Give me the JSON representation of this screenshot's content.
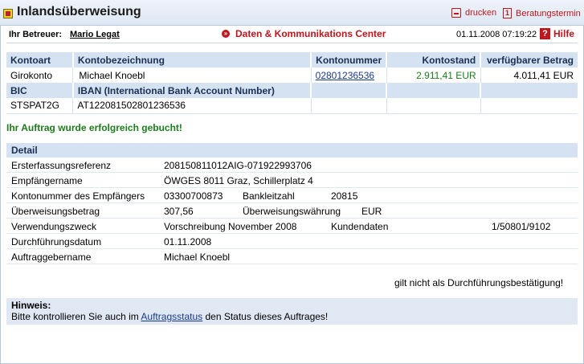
{
  "header": {
    "title": "Inlandsüberweisung",
    "print_label": "drucken",
    "termin_label": "Beratungstermin"
  },
  "subheader": {
    "betreuer_label": "Ihr Betreuer:",
    "betreuer_name": "Mario Legat",
    "center_link": "Daten & Kommunikations Center",
    "datetime": "01.11.2008 07:19:22",
    "help_label": "Hilfe"
  },
  "account": {
    "headers": [
      "Kontoart",
      "Kontobezeichnung",
      "Kontonummer",
      "Kontostand",
      "verfügbarer Betrag"
    ],
    "row": {
      "kontoart": "Girokonto",
      "bezeichnung": "Michael Knoebl",
      "nummer": "02801236536",
      "stand": "2.911,41 EUR",
      "verfuegbar": "4.011,41 EUR"
    },
    "headers2": [
      "BIC",
      "IBAN (International Bank Account Number)"
    ],
    "row2": {
      "bic": "STSPAT2G",
      "iban": "AT122081502801236536"
    }
  },
  "success_message": "Ihr Auftrag wurde erfolgreich gebucht!",
  "detail": {
    "heading": "Detail",
    "ersterfassung_label": "Ersterfassungsreferenz",
    "ersterfassung_value": "208150811012AIG-071922993706",
    "empfaenger_label": "Empfängername",
    "empfaenger_value": "ÖWGES 8011 Graz, Schillerplatz 4",
    "kontonr_label": "Kontonummer des Empfängers",
    "kontonr_value": "03300700873",
    "blz_label": "Bankleitzahl",
    "blz_value": "20815",
    "betrag_label": "Überweisungsbetrag",
    "betrag_value": "307,56",
    "waehrung_label": "Überweisungswährung",
    "waehrung_value": "EUR",
    "zweck_label": "Verwendungszweck",
    "zweck_value": "Vorschreibung November 2008",
    "kundendaten_label": "Kundendaten",
    "kundendaten_value": "1/50801/9102",
    "datum_label": "Durchführungsdatum",
    "datum_value": "01.11.2008",
    "auftraggeber_label": "Auftraggebername",
    "auftraggeber_value": "Michael Knoebl"
  },
  "note": "gilt nicht als Durchführungsbestätigung!",
  "hint": {
    "label": "Hinweis:",
    "text_before": "Bitte kontrollieren Sie auch im",
    "link": "Auftragsstatus",
    "text_after": "den Status dieses Auftrages!"
  },
  "colors": {
    "accent_red": "#c0151d",
    "header_blue": "#d4e2f2",
    "success_green": "#1d7d1d"
  }
}
